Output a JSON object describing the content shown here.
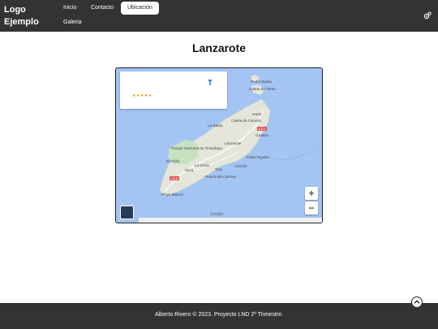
{
  "header": {
    "logo_line1": "Logo",
    "logo_line2": "Ejemplo",
    "nav": [
      {
        "label": "Inicio"
      },
      {
        "label": "Contacto"
      },
      {
        "label": "Ubicación",
        "active": true
      },
      {
        "label": "Galeria"
      }
    ],
    "settings_icon": "gear-icon"
  },
  "main": {
    "title": "Lanzarote",
    "map": {
      "card_stars": "★★★★★",
      "directions_icon": "directions-icon",
      "zoom_in_label": "+",
      "zoom_out_label": "−",
      "brand": "Google",
      "places": [
        "Pedro Barba",
        "Caleta del Sebo",
        "Haría",
        "Caleta de Famara",
        "La Santa",
        "Guatiza",
        "Lanzarote",
        "Parque Nacional de Timanfaya",
        "El Golfo",
        "Costa Teguise",
        "Yaiza",
        "La Geria",
        "Tías",
        "Arrecife",
        "Puerto del Carmen",
        "Playa Blanca"
      ],
      "roads": [
        "LZ-1",
        "LZ-2"
      ]
    }
  },
  "footer": {
    "text": "Alberto Rivero © 2023. Proyecto LND 2º Trimestre."
  },
  "colors": {
    "header_bg": "#333333",
    "water": "#a4c4f3",
    "land": "#e4e6dc",
    "park": "#c7e2c1",
    "road": "#e05555"
  }
}
